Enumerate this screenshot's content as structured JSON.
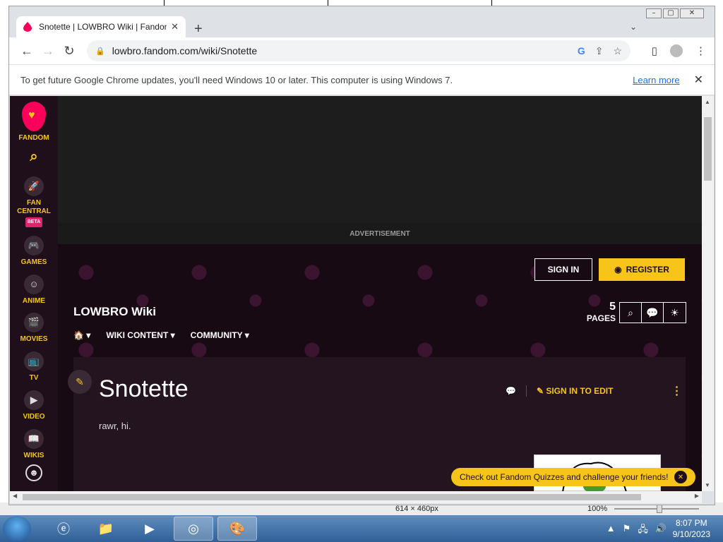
{
  "browser": {
    "tab_title": "Snotette | LOWBRO Wiki | Fandom",
    "tab_close": "✕",
    "new_tab": "+",
    "url": "lowbro.fandom.com/wiki/Snotette",
    "window_controls": [
      "–",
      "▢",
      "✕"
    ]
  },
  "infobar": {
    "message": "To get future Google Chrome updates, you'll need Windows 10 or later. This computer is using Windows 7.",
    "link": "Learn more",
    "close": "✕"
  },
  "fandom_sidebar": {
    "logo_label": "FANDOM",
    "items": [
      {
        "label": "FAN CENTRAL",
        "badge": "BETA",
        "icon": "rocket-icon"
      },
      {
        "label": "GAMES",
        "icon": "gamepad-icon"
      },
      {
        "label": "ANIME",
        "icon": "anime-face-icon"
      },
      {
        "label": "MOVIES",
        "icon": "clapper-icon"
      },
      {
        "label": "TV",
        "icon": "tv-icon"
      },
      {
        "label": "VIDEO",
        "icon": "video-icon"
      },
      {
        "label": "WIKIS",
        "icon": "book-icon"
      }
    ]
  },
  "ad": {
    "label": "ADVERTISEMENT"
  },
  "wiki_header": {
    "sign_in": "SIGN IN",
    "register": "REGISTER",
    "wiki_name": "LOWBRO Wiki",
    "pages_count": "5",
    "pages_label": "PAGES",
    "nav": [
      "WIKI CONTENT",
      "COMMUNITY"
    ]
  },
  "page": {
    "title": "Snotette",
    "sign_in_to_edit": "SIGN IN TO EDIT",
    "body_text": "rawr, hi."
  },
  "toast": {
    "message": "Check out Fandom Quizzes and challenge your friends!"
  },
  "paint_status": {
    "size": "614 × 460px",
    "zoom": "100%"
  },
  "taskbar": {
    "time": "8:07 PM",
    "date": "9/10/2023"
  },
  "colors": {
    "fandom_yellow": "#f7c51a",
    "fandom_pink": "#fa005a",
    "sidebar_bg": "#1f0f1a"
  }
}
